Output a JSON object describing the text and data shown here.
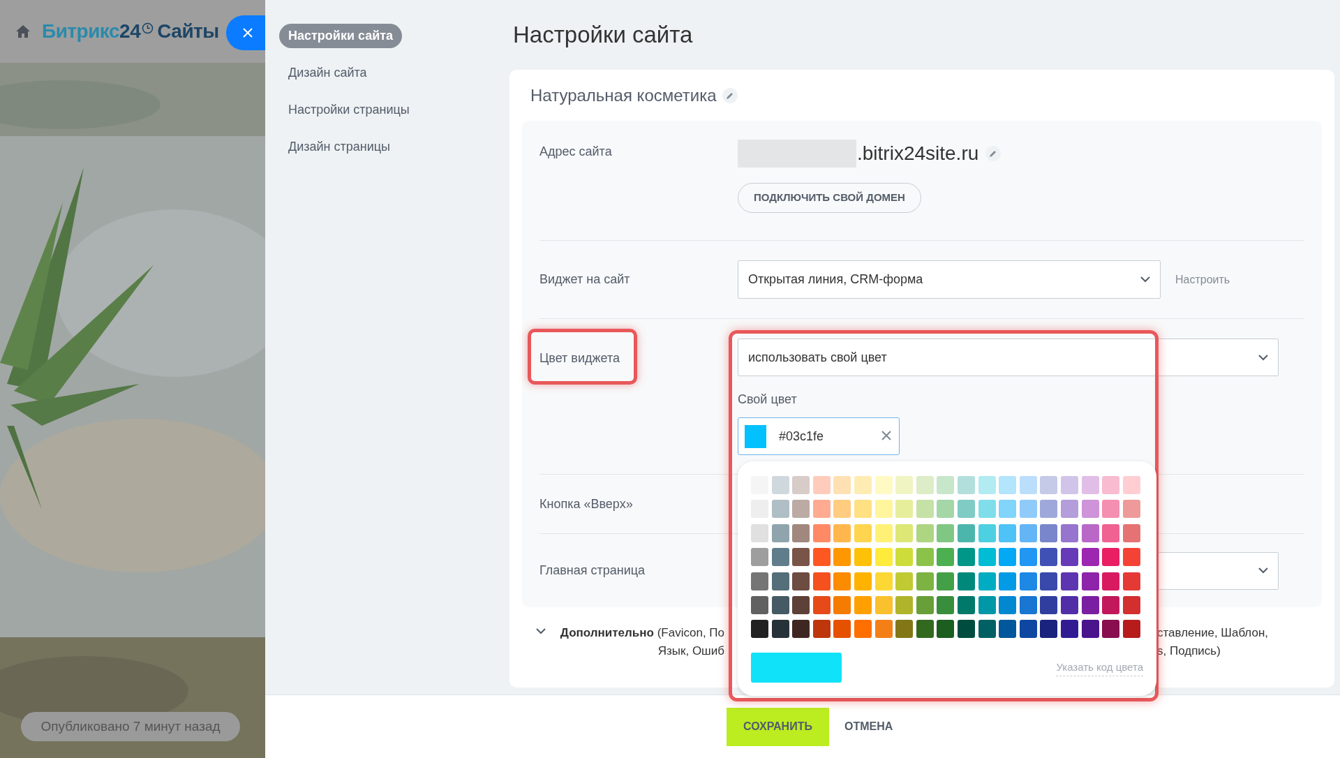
{
  "header": {
    "logo": {
      "brand": "Битрикс",
      "number": "24",
      "product": "Сайты"
    }
  },
  "publish_status": "Опубликовано 7 минут назад",
  "sidebar": {
    "items": [
      {
        "label": "Настройки сайта",
        "selected": true
      },
      {
        "label": "Дизайн сайта",
        "selected": false
      },
      {
        "label": "Настройки страницы",
        "selected": false
      },
      {
        "label": "Дизайн страницы",
        "selected": false
      }
    ]
  },
  "page_title": "Настройки сайта",
  "site": {
    "name": "Натуральная косметика",
    "address": {
      "label": "Адрес сайта",
      "domain": ".bitrix24site.ru",
      "button": "ПОДКЛЮЧИТЬ СВОЙ ДОМЕН"
    },
    "widget": {
      "label": "Виджет на сайт",
      "value": "Открытая линия, CRM-форма",
      "link": "Настроить"
    },
    "widget_color": {
      "label": "Цвет виджета",
      "highlighted": true,
      "value": "использовать свой цвет",
      "custom_label": "Свой цвет",
      "custom_value": "#03c1fe",
      "custom_swatch": {
        "color": "#03c1fe"
      },
      "picker": {
        "highlighted": true,
        "preview": {
          "color": "#10e3f9"
        },
        "code_link": "Указать код цвета",
        "rows": [
          {
            "swatches": [
              {
                "color": "#f5f5f5"
              },
              {
                "color": "#cfd8dc"
              },
              {
                "color": "#d7ccc8"
              },
              {
                "color": "#ffccbc"
              },
              {
                "color": "#ffe0b2"
              },
              {
                "color": "#ffecb3"
              },
              {
                "color": "#fff9c4"
              },
              {
                "color": "#f0f4c3"
              },
              {
                "color": "#dcedc8"
              },
              {
                "color": "#c8e6c9"
              },
              {
                "color": "#b2dfdb"
              },
              {
                "color": "#b2ebf2"
              },
              {
                "color": "#b3e5fc"
              },
              {
                "color": "#bbdefb"
              },
              {
                "color": "#c5cae9"
              },
              {
                "color": "#d1c4e9"
              },
              {
                "color": "#e1bee7"
              },
              {
                "color": "#f8bbd0"
              },
              {
                "color": "#ffcdd2"
              }
            ]
          },
          {
            "swatches": [
              {
                "color": "#eeeeee"
              },
              {
                "color": "#b0bec5"
              },
              {
                "color": "#bcaaa4"
              },
              {
                "color": "#ffab91"
              },
              {
                "color": "#ffcc80"
              },
              {
                "color": "#ffe082"
              },
              {
                "color": "#fff59d"
              },
              {
                "color": "#e6ee9c"
              },
              {
                "color": "#c5e1a5"
              },
              {
                "color": "#a5d6a7"
              },
              {
                "color": "#80cbc4"
              },
              {
                "color": "#80deea"
              },
              {
                "color": "#81d4fa"
              },
              {
                "color": "#90caf9"
              },
              {
                "color": "#9fa8da"
              },
              {
                "color": "#b39ddb"
              },
              {
                "color": "#ce93d8"
              },
              {
                "color": "#f48fb1"
              },
              {
                "color": "#ef9a9a"
              }
            ]
          },
          {
            "swatches": [
              {
                "color": "#e0e0e0"
              },
              {
                "color": "#90a4ae"
              },
              {
                "color": "#a1887f"
              },
              {
                "color": "#ff8a65"
              },
              {
                "color": "#ffb74d"
              },
              {
                "color": "#ffd54f"
              },
              {
                "color": "#fff176"
              },
              {
                "color": "#dce775"
              },
              {
                "color": "#aed581"
              },
              {
                "color": "#81c784"
              },
              {
                "color": "#4db6ac"
              },
              {
                "color": "#4dd0e1"
              },
              {
                "color": "#4fc3f7"
              },
              {
                "color": "#64b5f6"
              },
              {
                "color": "#7986cb"
              },
              {
                "color": "#9575cd"
              },
              {
                "color": "#ba68c8"
              },
              {
                "color": "#f06292"
              },
              {
                "color": "#e57373"
              }
            ]
          },
          {
            "swatches": [
              {
                "color": "#9e9e9e"
              },
              {
                "color": "#607d8b"
              },
              {
                "color": "#795548"
              },
              {
                "color": "#ff5722"
              },
              {
                "color": "#ff9800"
              },
              {
                "color": "#ffc107"
              },
              {
                "color": "#ffeb3b"
              },
              {
                "color": "#cddc39"
              },
              {
                "color": "#8bc34a"
              },
              {
                "color": "#4caf50"
              },
              {
                "color": "#009688"
              },
              {
                "color": "#00bcd4"
              },
              {
                "color": "#03a9f4"
              },
              {
                "color": "#2196f3"
              },
              {
                "color": "#3f51b5"
              },
              {
                "color": "#673ab7"
              },
              {
                "color": "#9c27b0"
              },
              {
                "color": "#e91e63"
              },
              {
                "color": "#f44336"
              }
            ]
          },
          {
            "swatches": [
              {
                "color": "#757575"
              },
              {
                "color": "#546e7a"
              },
              {
                "color": "#6d4c41"
              },
              {
                "color": "#f4511e"
              },
              {
                "color": "#fb8c00"
              },
              {
                "color": "#ffb300"
              },
              {
                "color": "#fdd835"
              },
              {
                "color": "#c0ca33"
              },
              {
                "color": "#7cb342"
              },
              {
                "color": "#43a047"
              },
              {
                "color": "#00897b"
              },
              {
                "color": "#00acc1"
              },
              {
                "color": "#039be5"
              },
              {
                "color": "#1e88e5"
              },
              {
                "color": "#3949ab"
              },
              {
                "color": "#5e35b1"
              },
              {
                "color": "#8e24aa"
              },
              {
                "color": "#d81b60"
              },
              {
                "color": "#e53935"
              }
            ]
          },
          {
            "swatches": [
              {
                "color": "#616161"
              },
              {
                "color": "#455a64"
              },
              {
                "color": "#5d4037"
              },
              {
                "color": "#e64a19"
              },
              {
                "color": "#f57c00"
              },
              {
                "color": "#ffa000"
              },
              {
                "color": "#fbc02d"
              },
              {
                "color": "#afb42b"
              },
              {
                "color": "#689f38"
              },
              {
                "color": "#388e3c"
              },
              {
                "color": "#00796b"
              },
              {
                "color": "#0097a7"
              },
              {
                "color": "#0288d1"
              },
              {
                "color": "#1976d2"
              },
              {
                "color": "#303f9f"
              },
              {
                "color": "#512da8"
              },
              {
                "color": "#7b1fa2"
              },
              {
                "color": "#c2185b"
              },
              {
                "color": "#d32f2f"
              }
            ]
          },
          {
            "swatches": [
              {
                "color": "#212121"
              },
              {
                "color": "#263238"
              },
              {
                "color": "#3e2723"
              },
              {
                "color": "#bf360c"
              },
              {
                "color": "#e65100"
              },
              {
                "color": "#ff6f00"
              },
              {
                "color": "#f57f17"
              },
              {
                "color": "#827717"
              },
              {
                "color": "#33691e"
              },
              {
                "color": "#1b5e20"
              },
              {
                "color": "#004d40"
              },
              {
                "color": "#006064"
              },
              {
                "color": "#01579b"
              },
              {
                "color": "#0d47a1"
              },
              {
                "color": "#1a237e"
              },
              {
                "color": "#311b92"
              },
              {
                "color": "#4a148c"
              },
              {
                "color": "#880e4f"
              },
              {
                "color": "#b71c1c"
              }
            ]
          }
        ]
      }
    },
    "scroll_top": {
      "label": "Кнопка «Вверх»"
    },
    "home_page": {
      "label": "Главная страница"
    },
    "additional": {
      "left_lines": [
        "**Дополнительно** (Favicon, По",
        "Язык, Ошиб"
      ],
      "right_lines": [
        "ставление, Шаблон,",
        "s, Подпись)"
      ]
    }
  },
  "footer": {
    "save": "СОХРАНИТЬ",
    "cancel": "ОТМЕНА"
  }
}
